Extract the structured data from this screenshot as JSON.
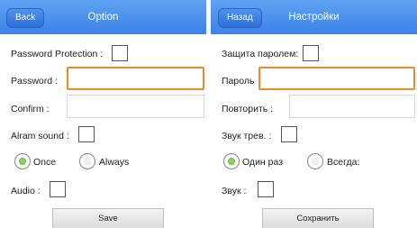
{
  "left": {
    "header": {
      "back_label": "Back",
      "title": "Option"
    },
    "password_protection_label": "Password Protection :",
    "password_label": "Password :",
    "confirm_label": "Confirm :",
    "alarm_sound_label": "Alram sound :",
    "radio_once_label": "Once",
    "radio_always_label": "Always",
    "audio_label": "Audio :",
    "save_label": "Save"
  },
  "right": {
    "header": {
      "back_label": "Назад",
      "title": "Настройки"
    },
    "password_protection_label": "Защита паролем:",
    "password_label": "Пароль",
    "confirm_label": "Повторить :",
    "alarm_sound_label": "Звук трев. :",
    "radio_once_label": "Один раз",
    "radio_always_label": "Всегда:",
    "audio_label": "Звук :",
    "save_label": "Сохранить"
  },
  "colors": {
    "header": "#3b82e6",
    "focus_border": "#f08a24",
    "radio_selected": "#4aa22b"
  }
}
